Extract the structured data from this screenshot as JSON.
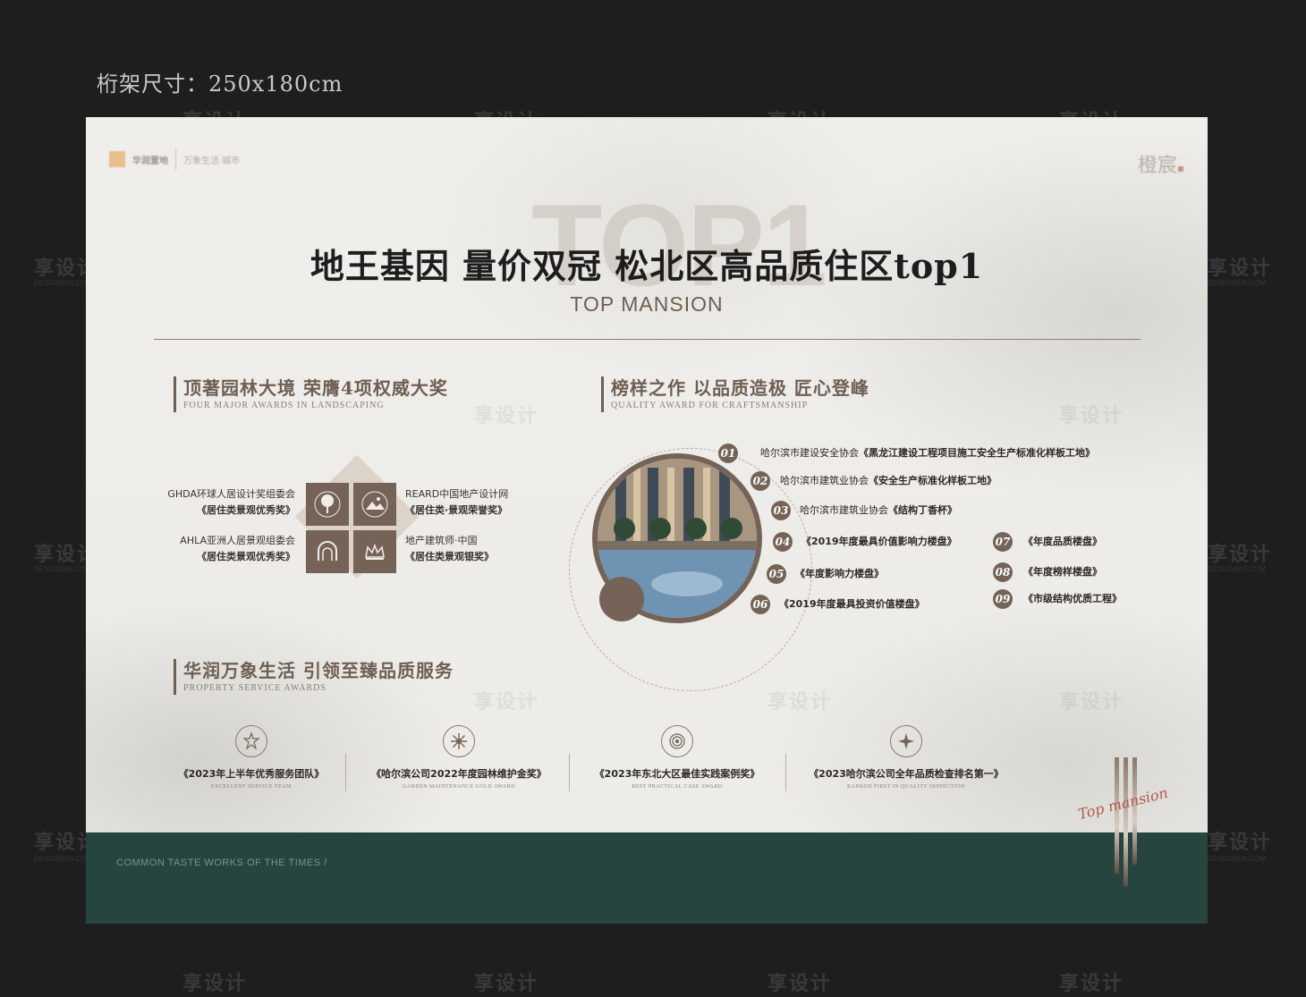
{
  "size_label": "桁架尺寸：250x180cm",
  "logo_left": {
    "brand": "华润置地",
    "sub": "万象生活·城市"
  },
  "logo_right": "橙宸",
  "top_bg_text": "TOP1",
  "headline": "地王基因 量价双冠  松北区高品质住区top1",
  "subheadline": "TOP MANSION",
  "landscape": {
    "title": "顶著园林大境 荣膺4项权威大奖",
    "subtitle": "FOUR MAJOR AWARDS IN LANDSCAPING",
    "awards": [
      {
        "org": "GHDA环球人居设计奖组委会",
        "name": "《居住类景观优秀奖》",
        "icon": "tree-icon"
      },
      {
        "org": "REARD中国地产设计网",
        "name": "《居住类·景观荣誉奖》",
        "icon": "landscape-icon"
      },
      {
        "org": "AHLA亚洲人居景观组委会",
        "name": "《居住类景观优秀奖》",
        "icon": "arch-icon"
      },
      {
        "org": "地产建筑师·中国",
        "name": "《居住类景观银奖》",
        "icon": "crown-icon"
      }
    ]
  },
  "quality": {
    "title": "榜样之作 以品质造极 匠心登峰",
    "subtitle": "QUALITY AWARD FOR CRAFTSMANSHIP",
    "items": [
      {
        "num": "01",
        "org": "哈尔滨市建设安全协会",
        "name": "《黑龙江建设工程项目施工安全生产标准化样板工地》"
      },
      {
        "num": "02",
        "org": "哈尔滨市建筑业协会",
        "name": "《安全生产标准化样板工地》"
      },
      {
        "num": "03",
        "org": "哈尔滨市建筑业协会",
        "name": "《结构丁香杯》"
      },
      {
        "num": "04",
        "org": "",
        "name": "《2019年度最具价值影响力楼盘》"
      },
      {
        "num": "05",
        "org": "",
        "name": "《年度影响力楼盘》"
      },
      {
        "num": "06",
        "org": "",
        "name": "《2019年度最具投资价值楼盘》"
      },
      {
        "num": "07",
        "org": "",
        "name": "《年度品质楼盘》"
      },
      {
        "num": "08",
        "org": "",
        "name": "《年度榜样楼盘》"
      },
      {
        "num": "09",
        "org": "",
        "name": "《市级结构优质工程》"
      }
    ]
  },
  "service": {
    "title": "华润万象生活 引领至臻品质服务",
    "subtitle": "PROPERTY SERVICE AWARDS",
    "awards": [
      {
        "name": "《2023年上半年优秀服务团队》",
        "en": "EXCELLENT SERVICE TEAM",
        "icon": "star-emblem-icon"
      },
      {
        "name": "《哈尔滨公司2022年度园林维护金奖》",
        "en": "GARDEN MAINTENANCE GOLD AWARD",
        "icon": "snowflake-emblem-icon"
      },
      {
        "name": "《2023年东北大区最佳实践案例奖》",
        "en": "BEST PRACTICAL CASE AWARD",
        "icon": "sun-emblem-icon"
      },
      {
        "name": "《2023哈尔滨公司全年品质检查排名第一》",
        "en": "RANKED FIRST IN QUALITY INSPECTION",
        "icon": "compass-emblem-icon"
      }
    ]
  },
  "signature": "Top mansion",
  "footer_slogan": "COMMON TASTE WORKS OF THE TIMES /",
  "watermark": {
    "text": "享设计",
    "domain": "DESIGN006.COM"
  },
  "colors": {
    "accent": "#756357",
    "footer": "#25453e",
    "background": "#1e1e1f"
  }
}
